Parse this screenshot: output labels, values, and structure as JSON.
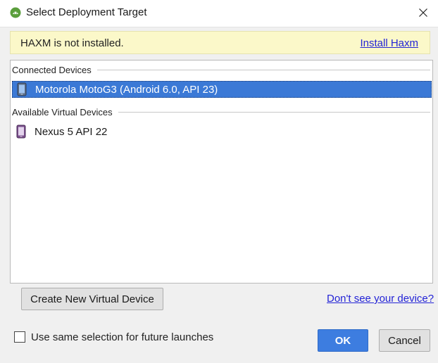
{
  "window": {
    "title": "Select Deployment Target",
    "app_icon": "android-studio-icon",
    "close_icon": "close-icon"
  },
  "banner": {
    "message": "HAXM is not installed.",
    "link_label": "Install Haxm"
  },
  "device_groups": {
    "connected": {
      "header": "Connected Devices",
      "devices": [
        {
          "name": "Motorola MotoG3 (Android 6.0, API 23)",
          "icon": "phone-icon",
          "selected": true
        }
      ]
    },
    "virtual": {
      "header": "Available Virtual Devices",
      "devices": [
        {
          "name": "Nexus 5 API 22",
          "icon": "emulator-phone-icon",
          "selected": false
        }
      ]
    }
  },
  "actions": {
    "create_virtual_device": "Create New Virtual Device",
    "dont_see_device": "Don't see your device?",
    "remember_selection": "Use same selection for future launches",
    "remember_checked": false,
    "ok": "OK",
    "cancel": "Cancel"
  },
  "colors": {
    "selection": "#3b79d6",
    "banner_bg": "#fbf8c9",
    "link": "#2323d6",
    "primary_button": "#3d7de0"
  }
}
